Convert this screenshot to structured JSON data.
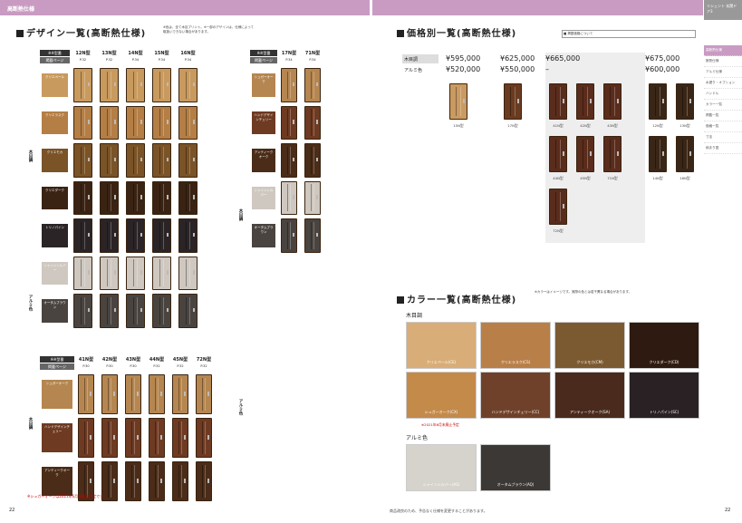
{
  "left_tab": "高断熱仕様",
  "right_tab": "リシェント 玄関ドア3",
  "design": {
    "title": "デザイン一覧(高断熱仕様)",
    "note": "※色は、全て木目プリント。※一部のデザインは、仕様によって取扱いできない場合があります。",
    "hdr_model": "※※型番",
    "hdr_page": "掲載ページ",
    "models": [
      "12N型",
      "13N型",
      "14N型",
      "15N型",
      "16N型"
    ],
    "pages": [
      "P.32",
      "P.32",
      "P.34",
      "P.34",
      "P.34"
    ],
    "models2": [
      "17N型",
      "71N型"
    ],
    "pages2": [
      "P.34",
      "P.34"
    ],
    "wood": "木目調",
    "alu": "アルミ色",
    "colors": [
      {
        "name": "クリエペール",
        "hex": "#c89a5e"
      },
      {
        "name": "クリエラスク",
        "hex": "#b47e45"
      },
      {
        "name": "クリエモカ",
        "hex": "#7a5327"
      },
      {
        "name": "クリエダーク",
        "hex": "#3a2313"
      },
      {
        "name": "トリノパイン",
        "hex": "#2a2426"
      },
      {
        "name": "シャインシルバー",
        "hex": "#cfc8c0"
      },
      {
        "name": "オータムブラウン",
        "hex": "#4a4440"
      }
    ],
    "colors2": [
      {
        "name": "シュガーオーク",
        "hex": "#b58650"
      },
      {
        "name": "ハンドデザインチェリー",
        "hex": "#6e3a22"
      },
      {
        "name": "アンティークオーク",
        "hex": "#4a2c18"
      },
      {
        "name": "シャインシルバー",
        "hex": "#cfc8c0"
      },
      {
        "name": "オータムブラウン",
        "hex": "#4a4440"
      }
    ],
    "models3": [
      "41N型",
      "42N型",
      "43N型",
      "44N型",
      "45N型",
      "72N型"
    ],
    "pages3": [
      "P.30",
      "P.30",
      "P.30",
      "P.32",
      "P.32",
      "P.32"
    ],
    "colors3": [
      {
        "name": "シュガーオーク",
        "hex": "#b58650"
      },
      {
        "name": "ハンドデザインチェリー",
        "hex": "#6e3a22"
      },
      {
        "name": "アンティークオーク",
        "hex": "#4a2c18"
      }
    ],
    "footnote": "※シュガーオークは2021年6月末廃止予定です。"
  },
  "price": {
    "title": "価格別一覧(高断熱仕様)",
    "legend": "■ 掲載価格について",
    "wood": "木目調",
    "alu": "アルミ色",
    "cols": [
      {
        "wood": "¥595,000",
        "alu": "¥520,000",
        "doors": [
          "15N型"
        ]
      },
      {
        "wood": "¥625,000",
        "alu": "¥550,000",
        "doors": [
          "17N型"
        ]
      },
      {
        "wood": "¥665,000",
        "alu": "–",
        "doors": [
          "41N型",
          "42N型",
          "43N型",
          "44N型",
          "45N型",
          "71N型",
          "72N型"
        ]
      },
      {
        "wood": "¥675,000",
        "alu": "¥600,000",
        "doors": [
          "12N型",
          "13N型",
          "14N型",
          "16N型"
        ]
      }
    ]
  },
  "color": {
    "title": "カラー一覧(高断熱仕様)",
    "note": "※カラーはイメージです。実際の色とは若干異なる場合があります。",
    "wood": "木目調",
    "alu": "アルミ色",
    "wood_swatches": [
      {
        "name": "クリエペール(CE)",
        "hex": "#d8ad77"
      },
      {
        "name": "クリエラスク(CS)",
        "hex": "#b97f48"
      },
      {
        "name": "クリエモカ(CM)",
        "hex": "#7c5a31"
      },
      {
        "name": "クリエダーク(CD)",
        "hex": "#2e1a10"
      },
      {
        "name": "シュガーオーク(CX)",
        "hex": "#c48a4a"
      },
      {
        "name": "ハンドデザインチェリー(CC)",
        "hex": "#70412a"
      },
      {
        "name": "アンティークオーク(SA)",
        "hex": "#4a2a1c"
      },
      {
        "name": "トリノパイン(SC)",
        "hex": "#2a2124"
      }
    ],
    "alu_swatches": [
      {
        "name": "シャインシルバー(AS)",
        "hex": "#d6d2cc"
      },
      {
        "name": "オータムブラウン(AQ)",
        "hex": "#3c3836"
      }
    ],
    "sugar_note": "※2021年6月末廃止予定"
  },
  "side_nav": [
    "高断熱仕様",
    "断熱仕様",
    "アルミ仕様",
    "水廻り・オプション",
    "ハンドル",
    "カラー一覧",
    "掲載一覧",
    "価格一覧",
    "寸法",
    "納まり図"
  ],
  "footer_left": "22",
  "footer_right": "22",
  "footer_text": "商品改良のため、予告なく仕様を変更することがあります。"
}
